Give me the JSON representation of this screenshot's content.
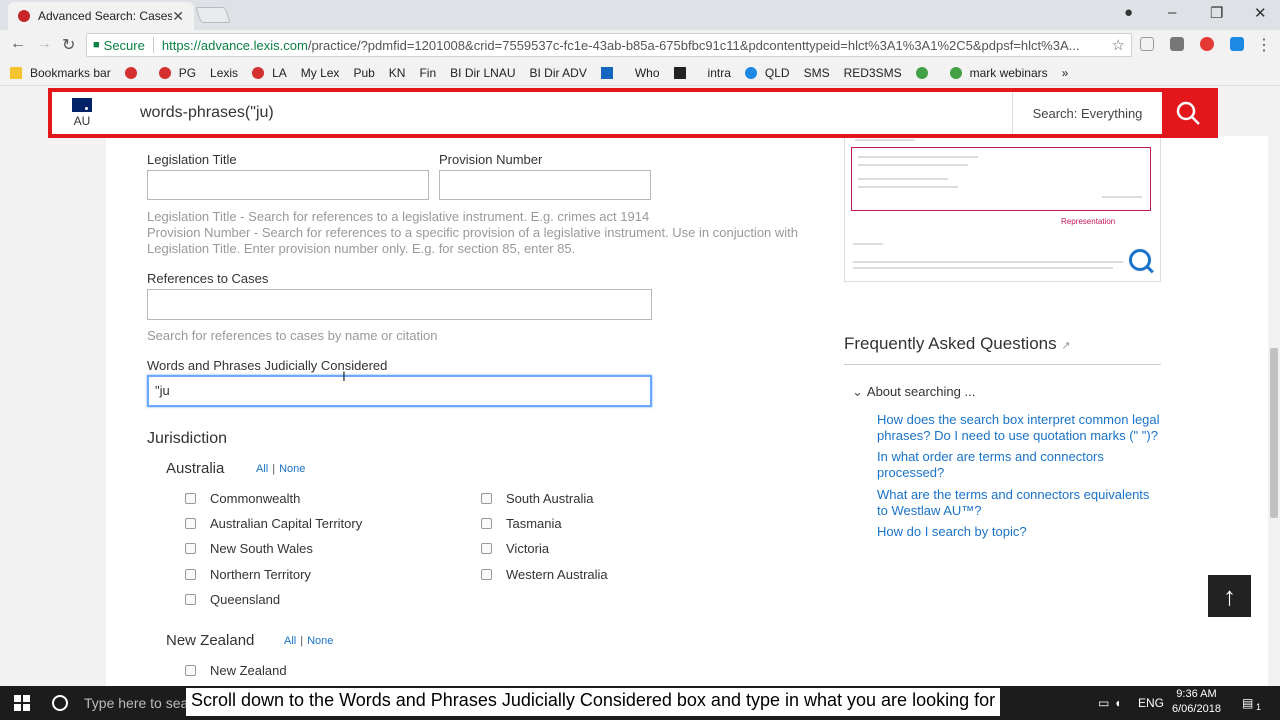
{
  "browser": {
    "tab_title": "Advanced Search: Cases",
    "tab_close": "✕",
    "secure_label": "Secure",
    "url_host": "https://advance.lexis.com",
    "url_path": "/practice/?pdmfid=1201008&crid=7559537c-fc1e-43ab-b85a-675bfbc91c11&pdcontenttypeid=hlct%3A1%3A1%2C5&pdpsf=hlct%3A...",
    "bookmarks": [
      "Bookmarks bar",
      "",
      "PG",
      "Lexis",
      "LA",
      "My Lex",
      "Pub",
      "KN",
      "Fin",
      "BI Dir LNAU",
      "BI Dir ADV",
      "",
      "Who",
      "",
      "intra",
      "QLD",
      "SMS",
      "RED3SMS",
      "",
      "mark webinars"
    ]
  },
  "search": {
    "region_code": "AU",
    "query": "words-phrases(\"ju)",
    "scope_label": "Search: Everything"
  },
  "form": {
    "legislation_title_label": "Legislation Title",
    "provision_number_label": "Provision Number",
    "legislation_help_1": "Legislation Title - Search for references to a legislative instrument. E.g. crimes act 1914",
    "legislation_help_2": "Provision Number - Search for references to a specific provision of a legislative instrument. Use in conjuction with Legislation Title. Enter provision number only. E.g. for section 85, enter 85.",
    "references_label": "References to Cases",
    "references_help": "Search for references to cases by name or citation",
    "words_label": "Words and Phrases Judicially Considered",
    "words_value": "\"ju",
    "jurisdiction_heading": "Jurisdiction",
    "all_label": "All",
    "none_label": "None",
    "australia_label": "Australia",
    "australia_left": [
      "Commonwealth",
      "Australian Capital Territory",
      "New South Wales",
      "Northern Territory",
      "Queensland"
    ],
    "australia_right": [
      "South Australia",
      "Tasmania",
      "Victoria",
      "Western Australia"
    ],
    "nz_label": "New Zealand",
    "nz_items": [
      "New Zealand"
    ]
  },
  "sidebar": {
    "preview_rep_label": "Representation",
    "faq_heading": "Frequently Asked Questions",
    "faq_sub": "About searching ...",
    "faq_links": [
      "How does the search box interpret common legal phrases? Do I need to use quotation marks (\" \")?",
      "In what order are terms and connectors processed?",
      "What are the terms and connectors equivalents to Westlaw AU™?",
      "How do I search by topic?"
    ]
  },
  "taskbar": {
    "search_placeholder": "Type here to sea",
    "lang": "ENG",
    "time": "9:36 AM",
    "date": "6/06/2018",
    "notif_count": "1"
  },
  "caption": "Scroll down to the Words and Phrases Judicially Considered box and type in what you are looking for"
}
